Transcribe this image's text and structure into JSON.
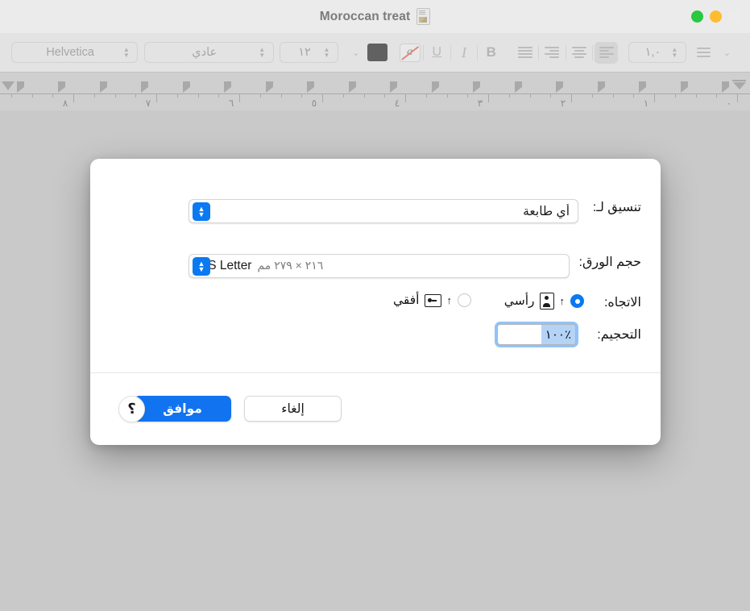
{
  "window": {
    "title": "Moroccan treat",
    "doc_icon": "document-icon",
    "traffic_lights": [
      {
        "name": "minimize-button",
        "color": "#28c840"
      },
      {
        "name": "zoom-button",
        "color": "#febc2e"
      },
      {
        "name": "close-button",
        "color": "#ececec"
      }
    ]
  },
  "toolbar": {
    "font_family": "Helvetica",
    "font_style": "عادي",
    "font_size": "١٢",
    "line_spacing": "١,٠",
    "text_color": "#616161",
    "bold_label": "B",
    "italic_label": "I",
    "underline_label": "U",
    "strikethrough_label": "a",
    "alignments": [
      "align-left",
      "align-center",
      "align-right",
      "align-justify"
    ],
    "active_alignment": "align-left"
  },
  "ruler": {
    "numbers": [
      "٨",
      "٧",
      "٦",
      "٥",
      "٤",
      "٣",
      "٢",
      "١",
      "٠"
    ],
    "unit": "inch"
  },
  "dialog": {
    "format_for": {
      "label": "تنسيق لـ:",
      "value": "أي طابعة"
    },
    "paper_size": {
      "label": "حجم الورق:",
      "value": "US Letter",
      "dimensions": "٢١٦ × ٢٧٩ مم"
    },
    "orientation": {
      "label": "الاتجاه:",
      "portrait_label": "رأسي",
      "landscape_label": "أفقي",
      "selected": "portrait"
    },
    "scale": {
      "label": "التحجيم:",
      "value": "٪١٠٠"
    },
    "buttons": {
      "ok": "موافق",
      "cancel": "إلغاء",
      "help": "؟"
    }
  },
  "colors": {
    "accent": "#0a79f2",
    "ok_button": "#1273f0",
    "window_chrome": "#ebebeb",
    "toolbar": "#e3e3e3",
    "ruler": "#cfcfcf",
    "doc_backdrop": "#c9c9c9"
  }
}
